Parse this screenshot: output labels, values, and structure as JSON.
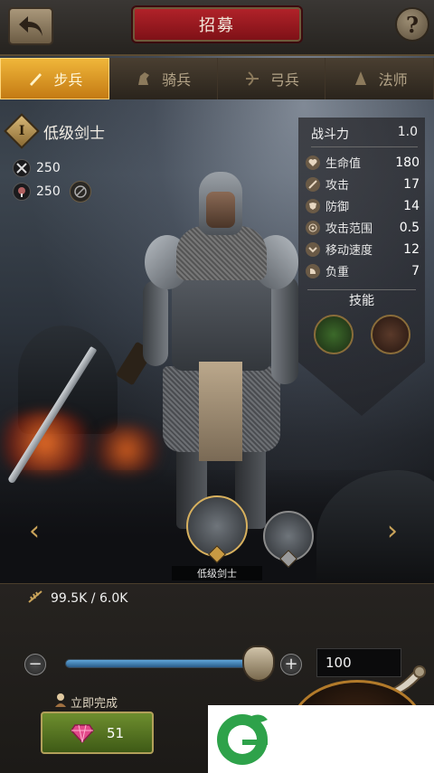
{
  "header": {
    "title": "招募"
  },
  "tabs": [
    {
      "label": "步兵",
      "icon": "infantry-icon",
      "active": true
    },
    {
      "label": "骑兵",
      "icon": "cavalry-icon",
      "active": false
    },
    {
      "label": "弓兵",
      "icon": "archer-icon",
      "active": false
    },
    {
      "label": "法师",
      "icon": "mage-icon",
      "active": false
    }
  ],
  "unit": {
    "rank": "I",
    "name": "低级剑士",
    "cost_a": "250",
    "cost_b": "250"
  },
  "stats": {
    "power_label": "战斗力",
    "power_value": "1.0",
    "rows": [
      {
        "label": "生命值",
        "value": "180",
        "icon": "heart-icon"
      },
      {
        "label": "攻击",
        "value": "17",
        "icon": "sword-icon"
      },
      {
        "label": "防御",
        "value": "14",
        "icon": "shield-icon"
      },
      {
        "label": "攻击范围",
        "value": "0.5",
        "icon": "target-icon"
      },
      {
        "label": "移动速度",
        "value": "12",
        "icon": "speed-icon"
      },
      {
        "label": "负重",
        "value": "7",
        "icon": "load-icon"
      }
    ],
    "skills_label": "技能"
  },
  "carousel": {
    "selected_label": "低级剑士",
    "main_rank": "I",
    "second_rank": "II"
  },
  "bottom": {
    "resource": "99.5K / 6.0K",
    "quantity": "100",
    "quantity_fraction": 1.0,
    "instant_label": "立即完成",
    "gem_cost": "51"
  },
  "colors": {
    "tab_active": "#e0a02a",
    "title_plate": "#9c1a20",
    "gem_button": "#5a7a24",
    "slider": "#4a90c8"
  }
}
